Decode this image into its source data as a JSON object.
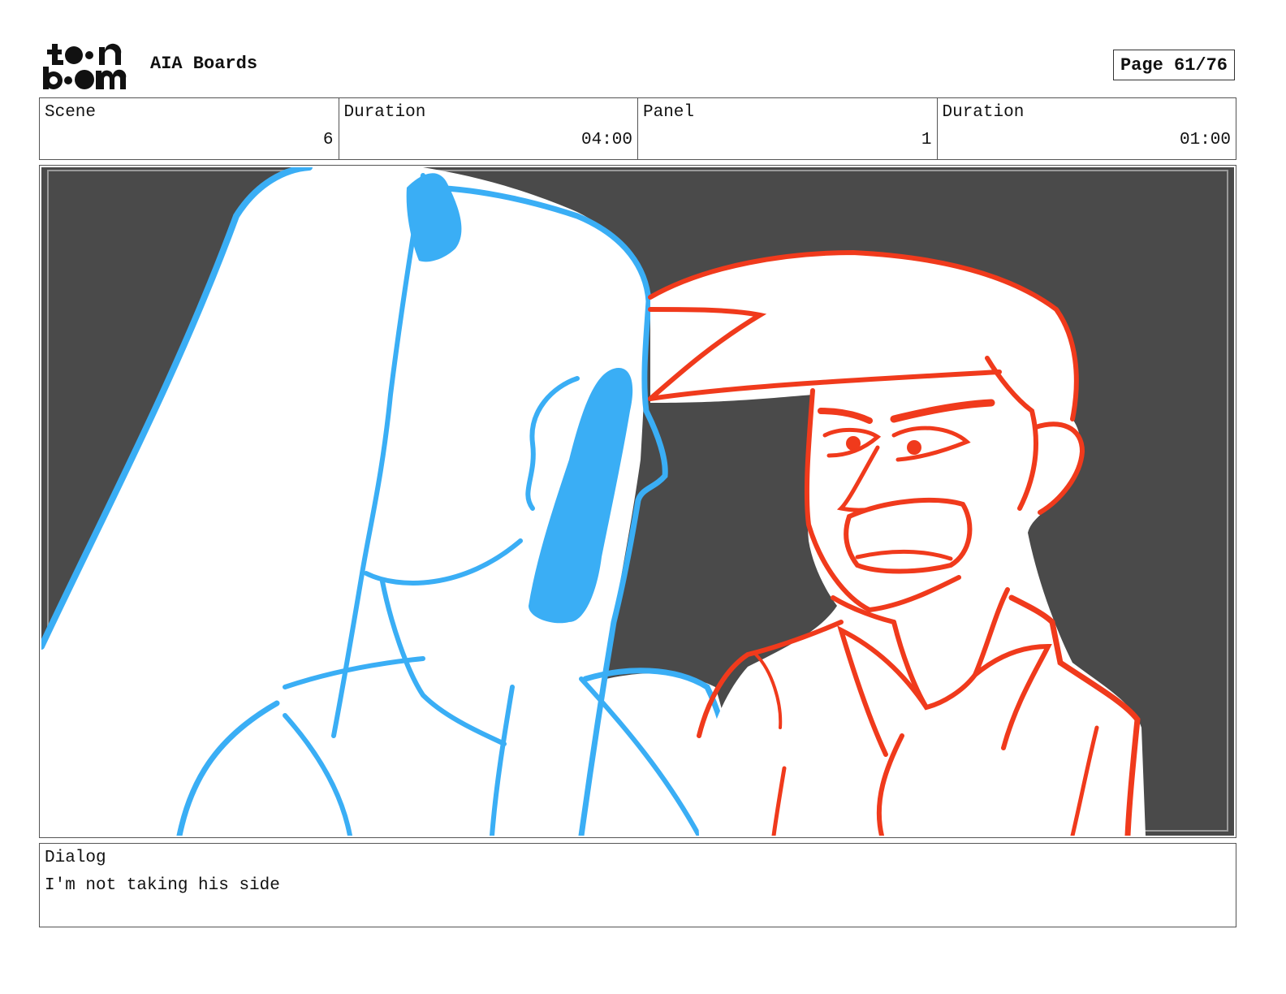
{
  "header": {
    "logo": {
      "icon": "toon-boom-logo",
      "line1": "toon",
      "line2": "boom"
    },
    "project_title": "AIA Boards",
    "page_label": "Page 61/76"
  },
  "info": {
    "scene_label": "Scene",
    "scene_value": "6",
    "scene_duration_label": "Duration",
    "scene_duration_value": "04:00",
    "panel_label": "Panel",
    "panel_value": "1",
    "panel_duration_label": "Duration",
    "panel_duration_value": "01:00"
  },
  "panel": {
    "background_color": "#4a4a4a",
    "girl_line_color": "#3aaef5",
    "boy_line_color": "#f03a1c"
  },
  "dialog": {
    "label": "Dialog",
    "text": "I'm not taking his side"
  }
}
